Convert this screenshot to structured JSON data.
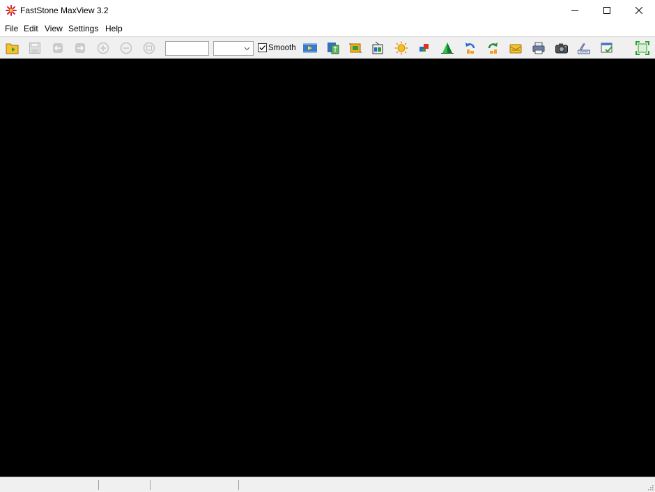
{
  "window": {
    "title": "FastStone MaxView 3.2",
    "icon": "faststone-app-icon",
    "controls": [
      "minimize-icon",
      "maximize-icon",
      "close-icon"
    ]
  },
  "menu": {
    "file": "File",
    "edit": "Edit",
    "view": "View",
    "settings": "Settings",
    "help": "Help"
  },
  "toolbar": {
    "zoom_value": "",
    "zoom_select_value": "",
    "smooth_label": "Smooth",
    "smooth_checked": true,
    "buttons": [
      {
        "icon": "open-folder-icon",
        "enabled": true
      },
      {
        "icon": "save-icon",
        "enabled": false
      },
      {
        "icon": "previous-icon",
        "enabled": false
      },
      {
        "icon": "next-icon",
        "enabled": false
      },
      {
        "icon": "zoom-in-icon",
        "enabled": false
      },
      {
        "icon": "zoom-out-icon",
        "enabled": false
      },
      {
        "icon": "actual-size-icon",
        "enabled": false
      },
      {
        "icon": "slideshow-icon",
        "enabled": true
      },
      {
        "icon": "resize-icon",
        "enabled": true
      },
      {
        "icon": "crop-icon",
        "enabled": true
      },
      {
        "icon": "color-adjust-icon",
        "enabled": true
      },
      {
        "icon": "brightness-icon",
        "enabled": true
      },
      {
        "icon": "effects-icon",
        "enabled": true
      },
      {
        "icon": "sharpen-icon",
        "enabled": true
      },
      {
        "icon": "rotate-left-icon",
        "enabled": true
      },
      {
        "icon": "rotate-right-icon",
        "enabled": true
      },
      {
        "icon": "email-icon",
        "enabled": true
      },
      {
        "icon": "print-icon",
        "enabled": true
      },
      {
        "icon": "camera-icon",
        "enabled": true
      },
      {
        "icon": "scanner-icon",
        "enabled": true
      },
      {
        "icon": "settings-check-icon",
        "enabled": true
      },
      {
        "icon": "fullscreen-icon",
        "enabled": true
      }
    ]
  },
  "viewer": {
    "background": "#000000"
  },
  "status": {
    "pane1": "",
    "pane2": "",
    "pane3": "",
    "pane4": ""
  },
  "colors": {
    "toolbar_bg": "#f0f0f0",
    "viewer_bg": "#000000",
    "accent_green": "#2e9e2e",
    "accent_orange": "#f0a020"
  }
}
